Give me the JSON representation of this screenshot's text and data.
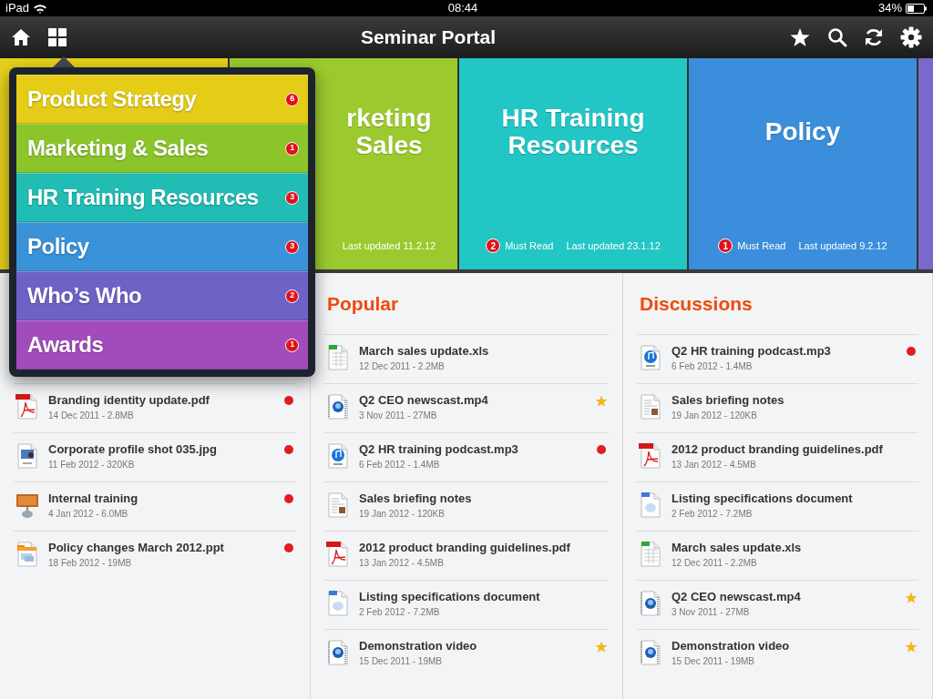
{
  "status_bar": {
    "device": "iPad",
    "time": "08:44",
    "battery": "34%"
  },
  "nav": {
    "title": "Seminar Portal"
  },
  "tiles": [
    {
      "color": "#e6d21c"
    },
    {
      "color": "#9cca2e",
      "covered": true,
      "title_lines": [
        "rketing",
        "Sales"
      ],
      "updated": "Last updated 11.2.12"
    },
    {
      "color": "#22c6c4",
      "covered": false,
      "title_lines": [
        "HR Training",
        "Resources"
      ],
      "must_read_count": "2",
      "must_read": "Must Read",
      "updated": "Last updated 23.1.12"
    },
    {
      "color": "#3b8edb",
      "covered": false,
      "title_lines": [
        "Policy"
      ],
      "must_read_count": "1",
      "must_read": "Must Read",
      "updated": "Last updated 9.2.12"
    },
    {
      "color": "#7a68cc"
    }
  ],
  "menu": [
    {
      "label": "Product Strategy",
      "count": "6",
      "color": "#e5cc16"
    },
    {
      "label": "Marketing & Sales",
      "count": "1",
      "color": "#8cc52a"
    },
    {
      "label": "HR Training Resources",
      "count": "3",
      "color": "#21bdb4"
    },
    {
      "label": "Policy",
      "count": "3",
      "color": "#3a92d8"
    },
    {
      "label": "Who’s Who",
      "count": "2",
      "color": "#6f62c6"
    },
    {
      "label": "Awards",
      "count": "1",
      "color": "#a24cbc"
    }
  ],
  "columns": [
    {
      "covered": true,
      "files": [
        {
          "kind": "pdf",
          "name": "Branding identity update.pdf",
          "meta": "14 Dec 2011 - 2.8MB",
          "unread": true,
          "starred": false
        },
        {
          "kind": "jpg",
          "name": "Corporate profile shot 035.jpg",
          "meta": "11 Feb 2012 - 320KB",
          "unread": true,
          "starred": false
        },
        {
          "kind": "key",
          "name": "Internal training",
          "meta": "4 Jan 2012 - 6.0MB",
          "unread": true,
          "starred": false
        },
        {
          "kind": "ppt",
          "name": "Policy changes March 2012.ppt",
          "meta": "18 Feb 2012 - 19MB",
          "unread": true,
          "starred": false
        }
      ]
    },
    {
      "title": "Popular",
      "files": [
        {
          "kind": "xls",
          "name": "March sales update.xls",
          "meta": "12 Dec 2011 - 2.2MB",
          "unread": false,
          "starred": false
        },
        {
          "kind": "mp4",
          "name": "Q2 CEO newscast.mp4",
          "meta": "3 Nov 2011 - 27MB",
          "unread": false,
          "starred": true
        },
        {
          "kind": "mp3",
          "name": "Q2 HR training podcast.mp3",
          "meta": "6 Feb 2012 - 1.4MB",
          "unread": true,
          "starred": false
        },
        {
          "kind": "notes",
          "name": "Sales briefing notes",
          "meta": "19 Jan 2012 - 120KB",
          "unread": false,
          "starred": false
        },
        {
          "kind": "pdf",
          "name": "2012 product branding guidelines.pdf",
          "meta": "13 Jan 2012 - 4.5MB",
          "unread": false,
          "starred": false
        },
        {
          "kind": "doc",
          "name": "Listing specifications document",
          "meta": "2 Feb 2012 - 7.2MB",
          "unread": false,
          "starred": false
        },
        {
          "kind": "mp4",
          "name": "Demonstration video",
          "meta": "15 Dec 2011 - 19MB",
          "unread": false,
          "starred": true
        }
      ]
    },
    {
      "title": "Discussions",
      "files": [
        {
          "kind": "mp3",
          "name": "Q2 HR training podcast.mp3",
          "meta": "6 Feb 2012 - 1.4MB",
          "unread": true,
          "starred": false
        },
        {
          "kind": "notes",
          "name": "Sales briefing notes",
          "meta": "19 Jan 2012 - 120KB",
          "unread": false,
          "starred": false
        },
        {
          "kind": "pdf",
          "name": "2012 product branding guidelines.pdf",
          "meta": "13 Jan 2012 - 4.5MB",
          "unread": false,
          "starred": false
        },
        {
          "kind": "doc",
          "name": "Listing specifications document",
          "meta": "2 Feb 2012 - 7.2MB",
          "unread": false,
          "starred": false
        },
        {
          "kind": "xls",
          "name": "March sales update.xls",
          "meta": "12 Dec 2011 - 2.2MB",
          "unread": false,
          "starred": false
        },
        {
          "kind": "mp4",
          "name": "Q2 CEO newscast.mp4",
          "meta": "3 Nov 2011 - 27MB",
          "unread": false,
          "starred": true
        },
        {
          "kind": "mp4",
          "name": "Demonstration video",
          "meta": "15 Dec 2011 - 19MB",
          "unread": false,
          "starred": true
        }
      ]
    }
  ]
}
